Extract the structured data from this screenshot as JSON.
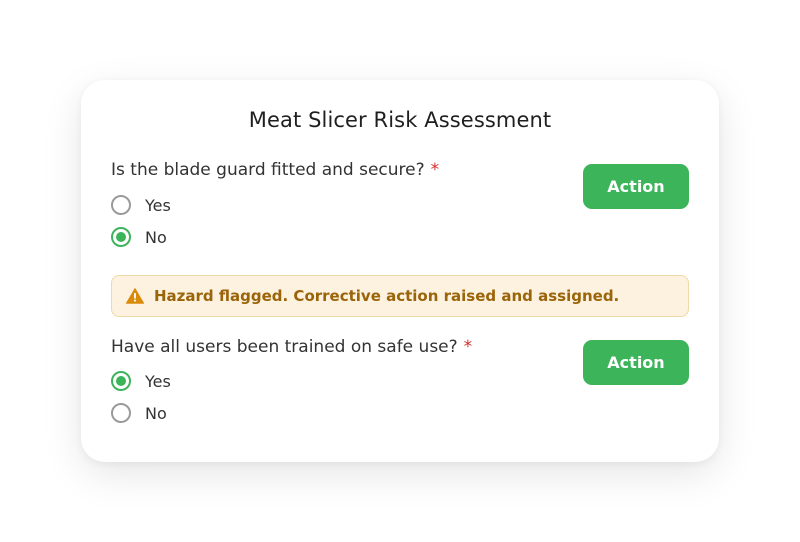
{
  "form": {
    "title": "Meat Slicer Risk Assessment",
    "required_marker": "*",
    "accent_color": "#3cb55a",
    "questions": [
      {
        "text": "Is the blade guard fitted and secure?",
        "options": [
          {
            "label": "Yes",
            "selected": false
          },
          {
            "label": "No",
            "selected": true
          }
        ],
        "action_label": "Action"
      },
      {
        "text": "Have all users been trained on safe use?",
        "options": [
          {
            "label": "Yes",
            "selected": true
          },
          {
            "label": "No",
            "selected": false
          }
        ],
        "action_label": "Action"
      }
    ],
    "alert": {
      "icon": "warning-icon",
      "text": "Hazard flagged. Corrective action raised and assigned.",
      "color": "#9a6408"
    }
  }
}
